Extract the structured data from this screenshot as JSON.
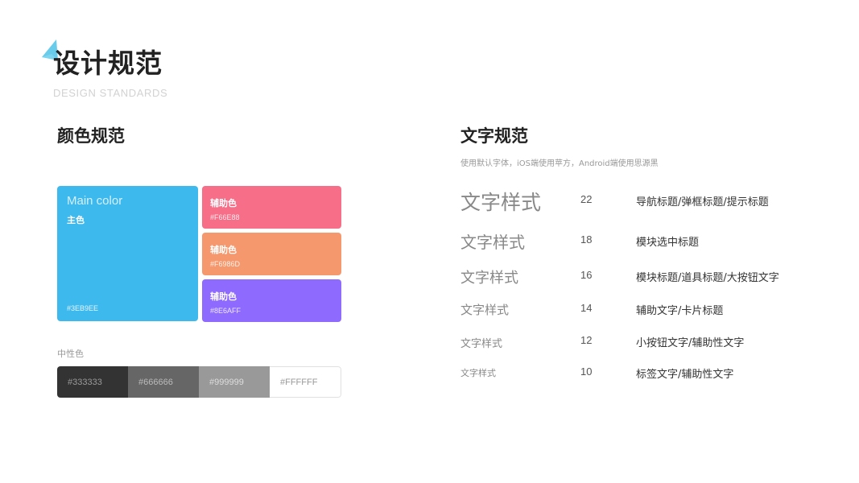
{
  "header": {
    "title": "设计规范",
    "subtitle": "DESIGN STANDARDS",
    "accent_color": "#4FC3E8"
  },
  "color_section": {
    "title": "颜色规范",
    "main": {
      "label_en": "Main color",
      "label_cn": "主色",
      "hex": "#3EB9EE",
      "color": "#3EB9EE"
    },
    "aux": [
      {
        "name": "辅助色",
        "hex": "#F66E88",
        "color": "#F66E88"
      },
      {
        "name": "辅助色",
        "hex": "#F6986D",
        "color": "#F6986D"
      },
      {
        "name": "辅助色",
        "hex": "#8E6AFF",
        "color": "#8E6AFF"
      }
    ],
    "neutral_label": "中性色",
    "neutrals": [
      {
        "hex": "#333333",
        "color": "#333333",
        "text_color": "#9a9a9a"
      },
      {
        "hex": "#666666",
        "color": "#666666",
        "text_color": "#bbbbbb"
      },
      {
        "hex": "#999999",
        "color": "#999999",
        "text_color": "#dddddd"
      },
      {
        "hex": "#FFFFFF",
        "color": "#FFFFFF",
        "text_color": "#999999"
      }
    ]
  },
  "type_section": {
    "title": "文字规范",
    "description": "使用默认字体，iOS端使用苹方，Android端使用思源黑",
    "rows": [
      {
        "sample": "文字样式",
        "size": "22",
        "usage": "导航标题/弹框标题/提示标题"
      },
      {
        "sample": "文字样式",
        "size": "18",
        "usage": "模块选中标题"
      },
      {
        "sample": "文字样式",
        "size": "16",
        "usage": "模块标题/道具标题/大按钮文字"
      },
      {
        "sample": "文字样式",
        "size": "14",
        "usage": "辅助文字/卡片标题"
      },
      {
        "sample": "文字样式",
        "size": "12",
        "usage": "小按钮文字/辅助性文字"
      },
      {
        "sample": "文字样式",
        "size": "10",
        "usage": "标签文字/辅助性文字"
      }
    ]
  }
}
